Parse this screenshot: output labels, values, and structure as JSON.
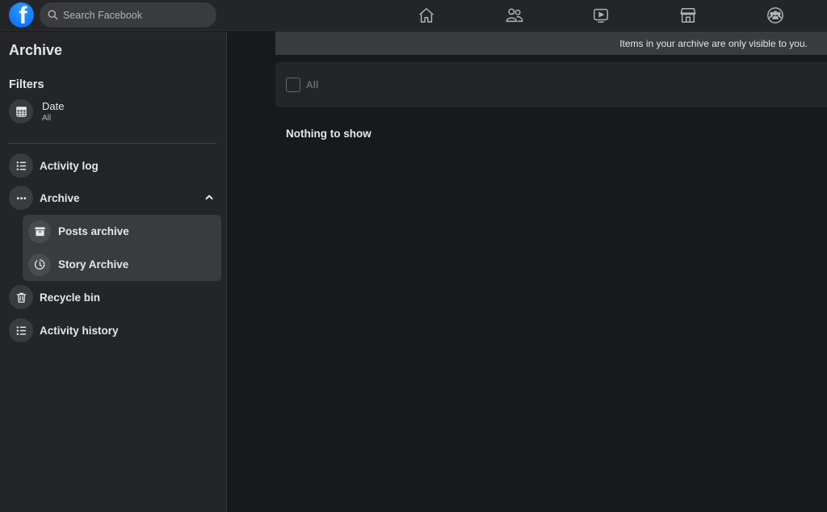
{
  "topbar": {
    "logo_letter": "f",
    "search_placeholder": "Search Facebook",
    "nav_icons": [
      "home-icon",
      "friends-icon",
      "watch-icon",
      "marketplace-icon",
      "groups-icon"
    ]
  },
  "sidebar": {
    "title": "Archive",
    "filters_heading": "Filters",
    "date_filter": {
      "label": "Date",
      "value": "All"
    },
    "items": [
      {
        "label": "Activity log",
        "icon": "list-icon"
      },
      {
        "label": "Archive",
        "icon": "more-icon",
        "expanded": true
      },
      {
        "label": "Posts archive",
        "icon": "archive-box-icon"
      },
      {
        "label": "Story Archive",
        "icon": "clock-icon"
      },
      {
        "label": "Recycle bin",
        "icon": "trash-icon"
      },
      {
        "label": "Activity history",
        "icon": "list-icon"
      }
    ]
  },
  "main": {
    "privacy_notice": "Items in your archive are only visible to you.",
    "select_all_label": "All",
    "empty_message": "Nothing to show"
  },
  "colors": {
    "brand": "#0866ff",
    "background": "#18191a",
    "surface": "#242526",
    "surface_hover": "#3a3b3c"
  }
}
